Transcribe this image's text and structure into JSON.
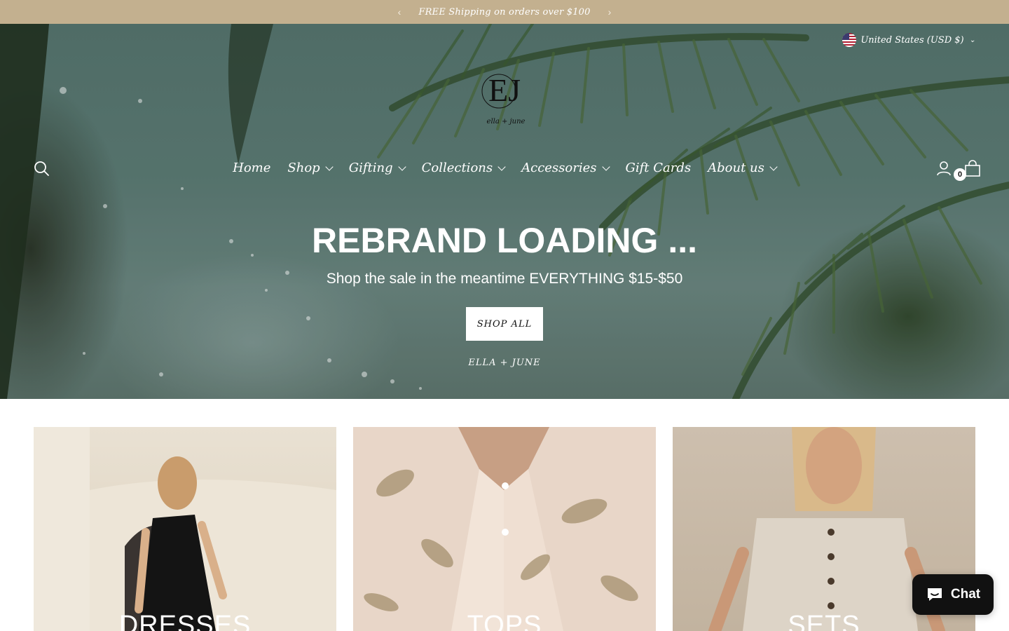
{
  "announcement": {
    "text": "FREE Shipping on orders over $100",
    "prev_icon": "chevron-left-icon",
    "next_icon": "chevron-right-icon"
  },
  "header": {
    "country_selector": "United States (USD $)",
    "logo_monogram": "EJ",
    "logo_script": "ella + june",
    "cart_count": "0",
    "icons": [
      "search-icon",
      "account-icon",
      "cart-icon"
    ]
  },
  "nav": {
    "items": [
      {
        "label": "Home",
        "has_dropdown": false
      },
      {
        "label": "Shop",
        "has_dropdown": true
      },
      {
        "label": "Gifting",
        "has_dropdown": true
      },
      {
        "label": "Collections",
        "has_dropdown": true
      },
      {
        "label": "Accessories",
        "has_dropdown": true
      },
      {
        "label": "Gift Cards",
        "has_dropdown": false
      },
      {
        "label": "About us",
        "has_dropdown": true
      }
    ]
  },
  "hero": {
    "title": "REBRAND LOADING ...",
    "subtitle": "Shop the sale in the meantime EVERYTHING $15-$50",
    "button_label": "SHOP ALL",
    "brand_caption": "ELLA + JUNE"
  },
  "collections": [
    {
      "label": "DRESSES"
    },
    {
      "label": "TOPS"
    },
    {
      "label": "SETS"
    }
  ],
  "chat": {
    "label": "Chat",
    "icon": "chat-bubble-icon"
  },
  "colors": {
    "announcement_bg": "#c3b08f",
    "chat_bg": "#111111"
  }
}
